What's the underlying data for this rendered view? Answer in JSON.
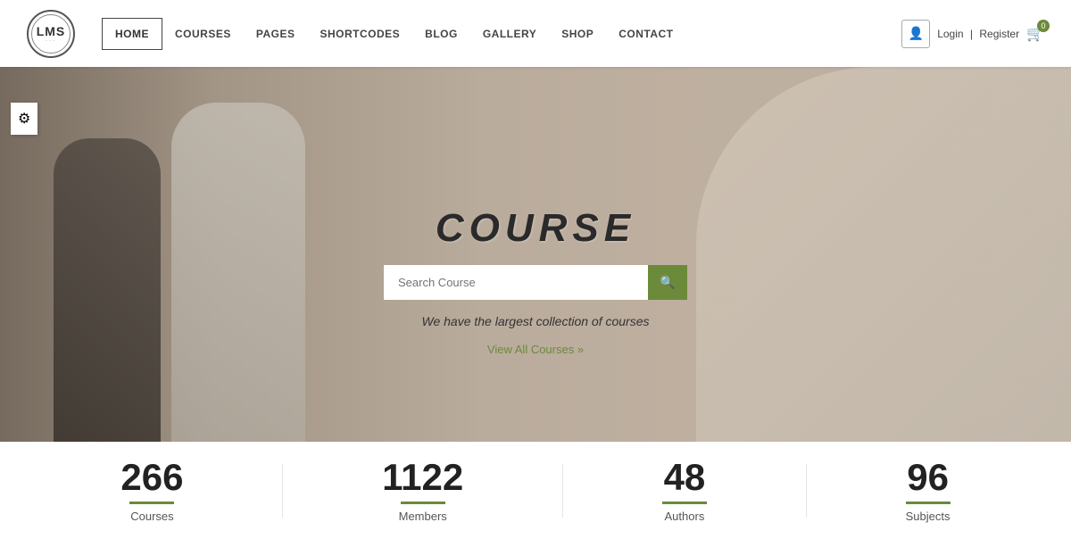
{
  "logo": {
    "text": "LMS",
    "subtitle": "Learning Management"
  },
  "navbar": {
    "items": [
      {
        "label": "HOME",
        "id": "home",
        "active": true
      },
      {
        "label": "COURSES",
        "id": "courses",
        "active": false
      },
      {
        "label": "PAGES",
        "id": "pages",
        "active": false
      },
      {
        "label": "SHORTCODES",
        "id": "shortcodes",
        "active": false
      },
      {
        "label": "BLOG",
        "id": "blog",
        "active": false
      },
      {
        "label": "GALLERY",
        "id": "gallery",
        "active": false
      },
      {
        "label": "SHOP",
        "id": "shop",
        "active": false
      },
      {
        "label": "CONTACT",
        "id": "contact",
        "active": false
      }
    ],
    "auth": {
      "login": "Login",
      "separator": "|",
      "register": "Register"
    },
    "cart_count": "0"
  },
  "hero": {
    "title": "CoUrse",
    "search_placeholder": "Search Course",
    "tagline": "We have the largest collection of courses",
    "cta": "View All Courses »"
  },
  "stats": [
    {
      "number": "266",
      "label": "Courses"
    },
    {
      "number": "1122",
      "label": "Members"
    },
    {
      "number": "48",
      "label": "Authors"
    },
    {
      "number": "96",
      "label": "Subjects"
    }
  ],
  "colors": {
    "accent": "#6b8a3a",
    "text_dark": "#222222",
    "text_mid": "#555555"
  },
  "icons": {
    "search": "🔍",
    "user": "👤",
    "cart": "🛒",
    "settings": "⚙"
  }
}
